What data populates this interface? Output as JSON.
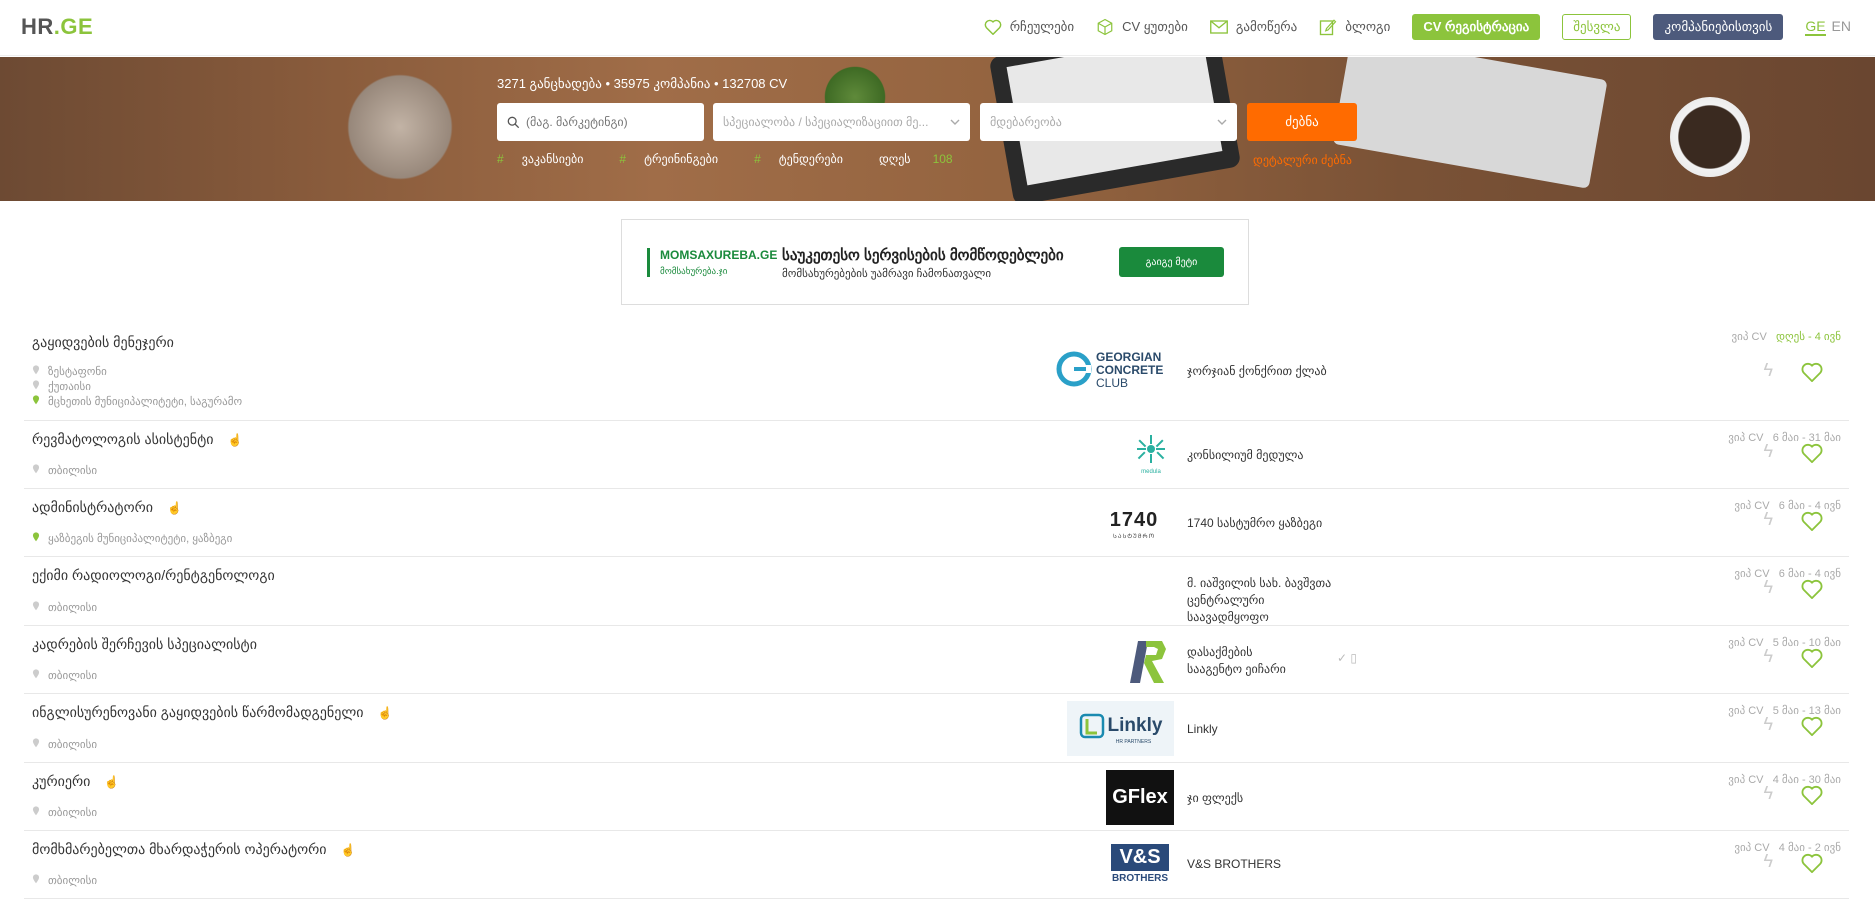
{
  "header": {
    "logo_hr": "HR",
    "logo_dot": ".",
    "logo_ge": "GE",
    "nav": {
      "favorites": "რჩეულები",
      "cv_box": "CV ყუთები",
      "subscribe": "გამოწერა",
      "blog": "ბლოგი"
    },
    "cv_register": "CV რეგისტრაცია",
    "login": "შესვლა",
    "for_companies": "კომპანიებისთვის",
    "lang_ge": "GE",
    "lang_en": "EN"
  },
  "hero": {
    "stats": "3271 განცხადება  •  35975 კომპანია  •  132708 CV",
    "search_placeholder": "(მაგ. მარკეტინგი)",
    "select_specialty": "სპეციალობა / სპეციალიზაციით მე...",
    "select_location": "მდებარეობა",
    "search_button": "ძებნა",
    "hashtags": [
      {
        "hash": "#",
        "label": "ვაკანსიები"
      },
      {
        "hash": "#",
        "label": "ტრეინინგები"
      },
      {
        "hash": "#",
        "label": "ტენდერები"
      }
    ],
    "today_label": "დღეს",
    "today_count": "108",
    "advanced_search": "დეტალური ძებნა"
  },
  "banner": {
    "brand": "MOMSAXUREBA.GE",
    "brand_sub": "მომსახურება.ჯი",
    "title": "საუკეთესო სერვისების მომწოდებლები",
    "subtitle": "მომსახურებების უამრავი ჩამონათვალი",
    "button": "გაიგე მეტი"
  },
  "jobs": [
    {
      "title": "გაყიდვების მენეჯერი",
      "locations": [
        "ზესტაფონი",
        "ქუთაისი",
        "მცხეთის მუნიციპალიტეტი, საგურამო"
      ],
      "company": "ჯორჯიან ქონქრით ქლაბ",
      "logo": "GEORGIAN CONCRETE CLUB",
      "date_prefix": "ვიპ CV",
      "date": "დღეს - 4 ივნ",
      "today": true
    },
    {
      "title": "რევმატოლოგის ასისტენტი",
      "locations": [
        "თბილისი"
      ],
      "company": "კონსილიუმ მედულა",
      "logo": "medula",
      "date_prefix": "ვიპ CV",
      "date": "6 მაი - 31 მაი"
    },
    {
      "title": "ადმინისტრატორი",
      "locations": [
        "ყაზბეგის მუნიციპალიტეტი, ყაზბეგი"
      ],
      "company": "1740 სასტუმრო ყაზბეგი",
      "logo": "1740",
      "logo_sub": "ᲡᲐᲡᲢᲣᲛᲠᲝ",
      "date_prefix": "ვიპ CV",
      "date": "6 მაი - 4 ივნ"
    },
    {
      "title": "ექიმი რადიოლოგი/რენტგენოლოგი",
      "locations": [
        "თბილისი"
      ],
      "company": "მ. იაშვილის სახ. ბავშვთა ცენტრალური საავადმყოფო",
      "logo": "",
      "date_prefix": "ვიპ CV",
      "date": "6 მაი - 4 ივნ"
    },
    {
      "title": "კადრების შერჩევის სპეციალისტი",
      "locations": [
        "თბილისი"
      ],
      "company": "დასაქმების სააგენტო ეიჩარი",
      "logo": "HR",
      "date_prefix": "ვიპ CV",
      "date": "5 მაი - 10 მაი"
    },
    {
      "title": "ინგლისურენოვანი გაყიდვების წარმომადგენელი",
      "locations": [
        "თბილისი"
      ],
      "company": "Linkly",
      "logo": "Linkly",
      "logo_sub": "HR PARTNERS",
      "date_prefix": "ვიპ CV",
      "date": "5 მაი - 13 მაი"
    },
    {
      "title": "კურიერი",
      "locations": [
        "თბილისი"
      ],
      "company": "ჯი ფლექს",
      "logo": "GFlex",
      "date_prefix": "ვიპ CV",
      "date": "4 მაი - 30 მაი"
    },
    {
      "title": "მომხმარებელთა მხარდაჭერის ოპერატორი",
      "locations": [
        "თბილისი"
      ],
      "company": "V&S BROTHERS",
      "logo": "V&S",
      "logo_sub": "BROTHERS",
      "date_prefix": "ვიპ CV",
      "date": "4 მაი - 2 ივნ"
    }
  ],
  "colors": {
    "brand_green": "#8cc43c",
    "search_orange": "#ff6b00",
    "company_btn": "#4d5a7c"
  }
}
